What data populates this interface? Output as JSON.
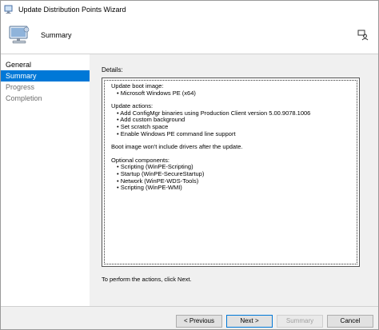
{
  "window": {
    "title": "Update Distribution Points Wizard"
  },
  "header": {
    "page_title": "Summary"
  },
  "nav": {
    "items": [
      {
        "label": "General",
        "state": "header"
      },
      {
        "label": "Summary",
        "state": "active"
      },
      {
        "label": "Progress",
        "state": "inactive"
      },
      {
        "label": "Completion",
        "state": "inactive"
      }
    ]
  },
  "content": {
    "details_label": "Details:",
    "details_lines": [
      {
        "text": "Update boot image:",
        "sub": false
      },
      {
        "text": "•  Microsoft Windows PE (x64)",
        "sub": true
      },
      {
        "text": "",
        "gap": true
      },
      {
        "text": "Update actions:",
        "sub": false
      },
      {
        "text": "•  Add ConfigMgr binaries using Production Client version 5.00.9078.1006",
        "sub": true
      },
      {
        "text": "•  Add custom background",
        "sub": true
      },
      {
        "text": "•  Set scratch space",
        "sub": true
      },
      {
        "text": "•  Enable Windows PE command line support",
        "sub": true
      },
      {
        "text": "",
        "gap": true
      },
      {
        "text": "Boot image won't include drivers after the update.",
        "sub": false
      },
      {
        "text": "",
        "gap": true
      },
      {
        "text": "Optional components:",
        "sub": false
      },
      {
        "text": "•  Scripting (WinPE-Scripting)",
        "sub": true
      },
      {
        "text": "•  Startup (WinPE-SecureStartup)",
        "sub": true
      },
      {
        "text": "•  Network (WinPE-WDS-Tools)",
        "sub": true
      },
      {
        "text": "•  Scripting (WinPE-WMI)",
        "sub": true
      }
    ],
    "footer_note": "To perform the actions, click Next."
  },
  "buttons": {
    "previous": "< Previous",
    "next": "Next >",
    "summary": "Summary",
    "cancel": "Cancel"
  },
  "colors": {
    "accent": "#0078d7",
    "content_bg": "#f0f0f0"
  }
}
